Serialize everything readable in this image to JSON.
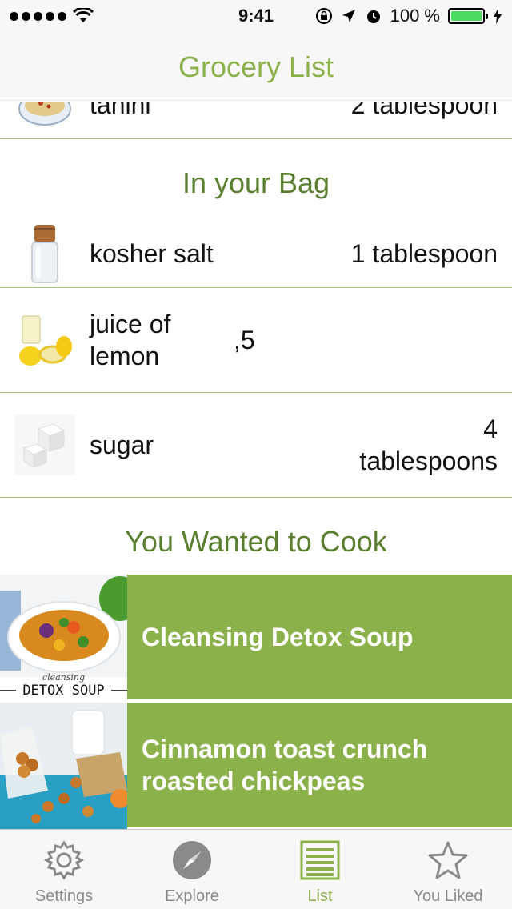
{
  "status_bar": {
    "time": "9:41",
    "battery": "100 %"
  },
  "nav": {
    "title": "Grocery List"
  },
  "partial_item": {
    "name": "tahini",
    "qty": "2 tablespoon"
  },
  "bag": {
    "title": "In your Bag",
    "items": [
      {
        "name": "kosher salt",
        "qty": "1 tablespoon"
      },
      {
        "name": "juice of lemon",
        "qty": ",5"
      },
      {
        "name": "sugar",
        "qty": "4 tablespoons"
      }
    ]
  },
  "wanted": {
    "title": "You Wanted to Cook",
    "recipes": [
      {
        "title": "Cleansing Detox Soup",
        "image_caption_script": "cleansing",
        "image_caption": "DETOX SOUP"
      },
      {
        "title": "Cinnamon toast crunch roasted chickpeas"
      }
    ]
  },
  "tabs": [
    {
      "label": "Settings",
      "icon": "gear-icon"
    },
    {
      "label": "Explore",
      "icon": "compass-icon"
    },
    {
      "label": "List",
      "icon": "list-icon",
      "active": true
    },
    {
      "label": "You Liked",
      "icon": "star-icon"
    }
  ],
  "colors": {
    "accent": "#8bb14a",
    "section": "#5a7f2f",
    "divider": "#a9c27a"
  }
}
